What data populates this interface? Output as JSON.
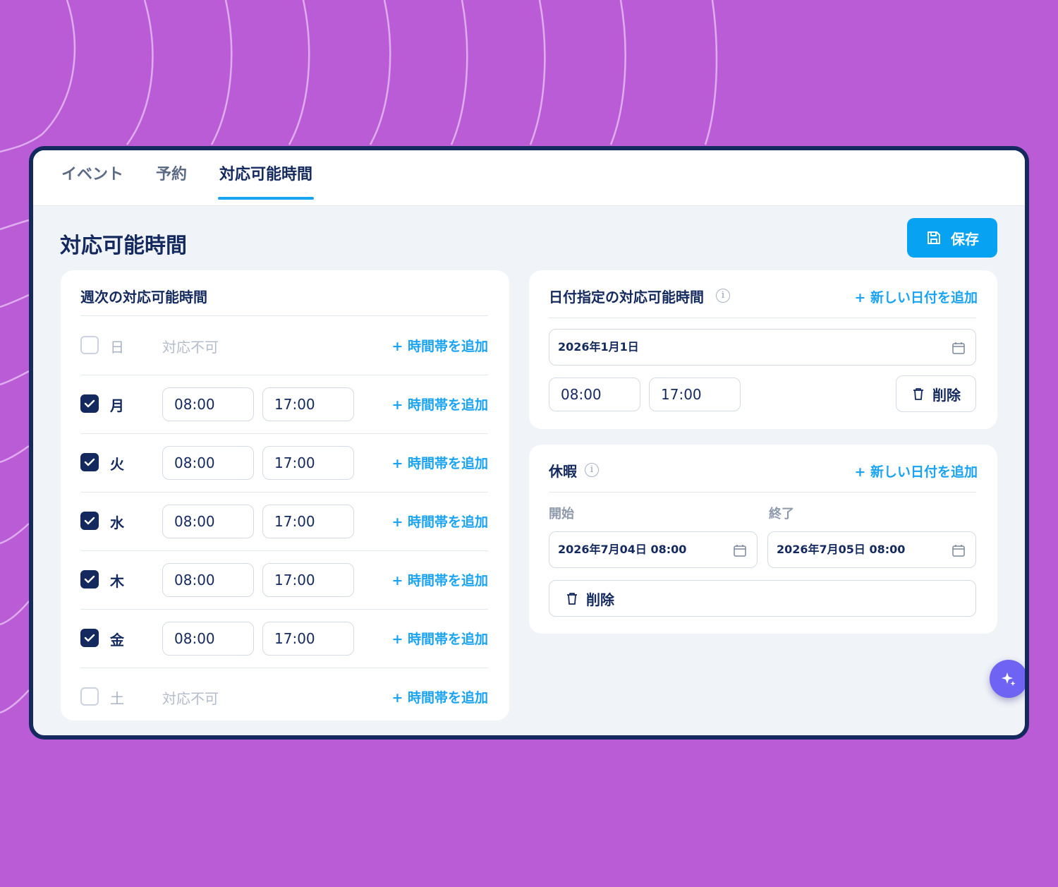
{
  "tabs": [
    {
      "label": "イベント"
    },
    {
      "label": "予約"
    },
    {
      "label": "対応可能時間",
      "active": true
    }
  ],
  "page": {
    "title": "対応可能時間",
    "save_label": "保存"
  },
  "weekly": {
    "title": "週次の対応可能時間",
    "add_label": "+ 時間帯を追加",
    "unavailable_label": "対応不可",
    "days": [
      {
        "day": "日",
        "enabled": false
      },
      {
        "day": "月",
        "enabled": true,
        "start": "08:00",
        "end": "17:00"
      },
      {
        "day": "火",
        "enabled": true,
        "start": "08:00",
        "end": "17:00"
      },
      {
        "day": "水",
        "enabled": true,
        "start": "08:00",
        "end": "17:00"
      },
      {
        "day": "木",
        "enabled": true,
        "start": "08:00",
        "end": "17:00"
      },
      {
        "day": "金",
        "enabled": true,
        "start": "08:00",
        "end": "17:00"
      },
      {
        "day": "土",
        "enabled": false
      }
    ]
  },
  "date_specific": {
    "title": "日付指定の対応可能時間",
    "add_label": "+ 新しい日付を追加",
    "date": "2026年1月1日",
    "start": "08:00",
    "end": "17:00",
    "delete_label": "削除"
  },
  "vacation": {
    "title": "休暇",
    "add_label": "+ 新しい日付を追加",
    "start_label": "開始",
    "end_label": "終了",
    "start_value": "2026年7月04日 08:00",
    "end_value": "2026年7月05日 08:00",
    "delete_label": "削除"
  },
  "colors": {
    "background": "#bb5cd7",
    "navy": "#14295e",
    "accent": "#1aa3f0",
    "fab": "#6e63f2"
  }
}
